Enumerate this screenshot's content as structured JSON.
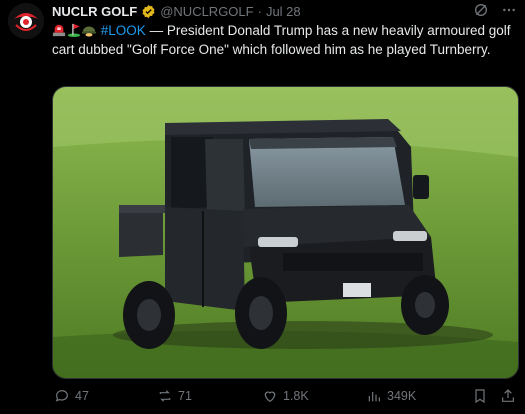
{
  "author": {
    "display_name": "NUCLR GOLF",
    "handle": "@NUCLRGOLF",
    "separator": "·",
    "date": "Jul 28"
  },
  "tweet": {
    "hashtag": "#LOOK",
    "text": "— President Donald Trump has a new heavily armoured golf cart dubbed \"Golf Force One\" which followed him as he played Turnberry."
  },
  "actions": {
    "replies": "47",
    "reposts": "71",
    "likes": "1.8K",
    "views": "349K"
  },
  "colors": {
    "accent": "#1d9bf0",
    "verified_badge": "#e2b719",
    "muted": "#71767b"
  },
  "icons": [
    "grok-icon",
    "more-icon",
    "reply-icon",
    "repost-icon",
    "like-icon",
    "views-icon",
    "bookmark-icon",
    "share-icon"
  ]
}
